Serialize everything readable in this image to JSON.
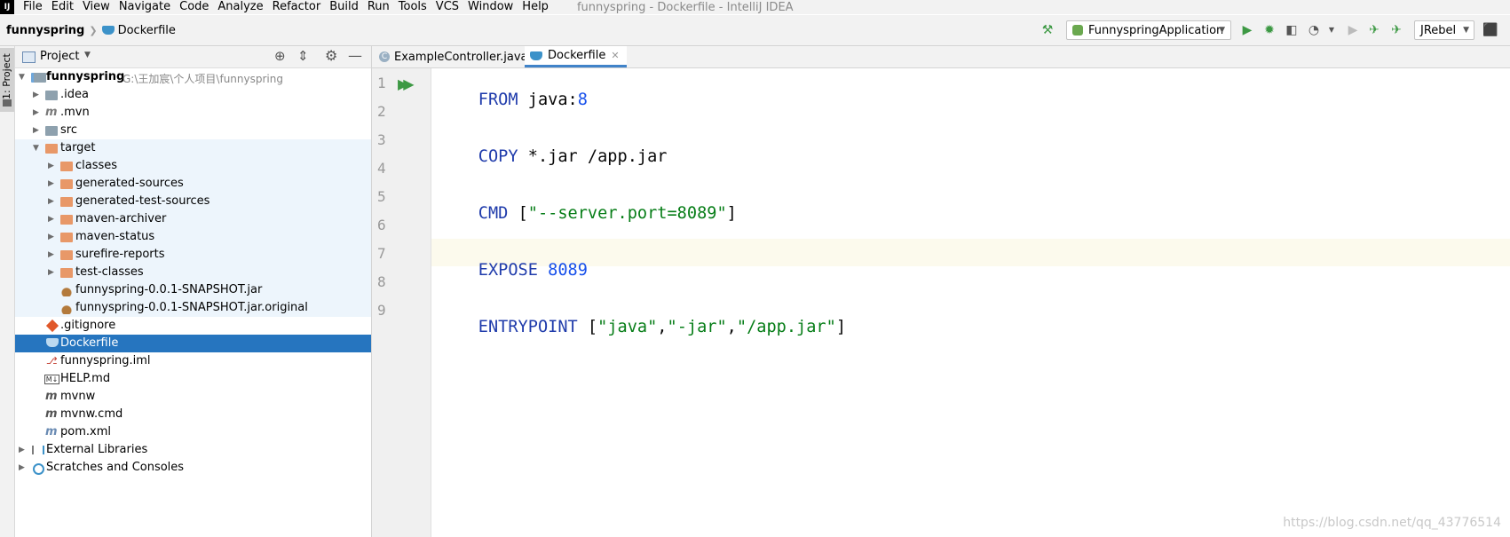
{
  "menubar": {
    "logo": "IJ",
    "items": [
      "File",
      "Edit",
      "View",
      "Navigate",
      "Code",
      "Analyze",
      "Refactor",
      "Build",
      "Run",
      "Tools",
      "VCS",
      "Window",
      "Help"
    ],
    "window_title": "funnyspring - Dockerfile - IntelliJ IDEA"
  },
  "navbar": {
    "project": "funnyspring",
    "file": "Dockerfile",
    "run_config": "FunnyspringApplication",
    "jrebel": "JRebel"
  },
  "stripe": {
    "project_tab": "1: Project"
  },
  "project_panel": {
    "title": "Project",
    "root": {
      "name": "funnyspring",
      "path": "G:\\王加宸\\个人项目\\funnyspring"
    },
    "items": [
      {
        "label": ".idea"
      },
      {
        "label": ".mvn"
      },
      {
        "label": "src"
      },
      {
        "label": "target"
      },
      {
        "label": "classes"
      },
      {
        "label": "generated-sources"
      },
      {
        "label": "generated-test-sources"
      },
      {
        "label": "maven-archiver"
      },
      {
        "label": "maven-status"
      },
      {
        "label": "surefire-reports"
      },
      {
        "label": "test-classes"
      },
      {
        "label": "funnyspring-0.0.1-SNAPSHOT.jar"
      },
      {
        "label": "funnyspring-0.0.1-SNAPSHOT.jar.original"
      },
      {
        "label": ".gitignore"
      },
      {
        "label": "Dockerfile"
      },
      {
        "label": "funnyspring.iml"
      },
      {
        "label": "HELP.md"
      },
      {
        "label": "mvnw"
      },
      {
        "label": "mvnw.cmd"
      },
      {
        "label": "pom.xml"
      },
      {
        "label": "External Libraries"
      },
      {
        "label": "Scratches and Consoles"
      }
    ]
  },
  "editor": {
    "tabs": [
      {
        "label": "ExampleController.java",
        "icon": "C"
      },
      {
        "label": "Dockerfile"
      }
    ],
    "line_numbers": [
      "1",
      "2",
      "3",
      "4",
      "5",
      "6",
      "7",
      "8",
      "9"
    ],
    "lines": {
      "l1": {
        "kw": "FROM",
        "plain": " java:",
        "num": "8"
      },
      "l3": {
        "kw": "COPY",
        "plain": " *.jar /app.jar"
      },
      "l5": {
        "kw": "CMD",
        "plain": " [",
        "str": "\"--server.port=8089\"",
        "plain2": "]"
      },
      "l7": {
        "kw": "EXPOSE",
        "num": " 8089"
      },
      "l9": {
        "kw": "ENTRYPOINT",
        "plain": " [",
        "s1": "\"java\"",
        "c1": ",",
        "s2": "\"-jar\"",
        "c2": ",",
        "s3": "\"/app.jar\"",
        "plain2": "]"
      }
    }
  },
  "watermark": "https://blog.csdn.net/qq_43776514"
}
